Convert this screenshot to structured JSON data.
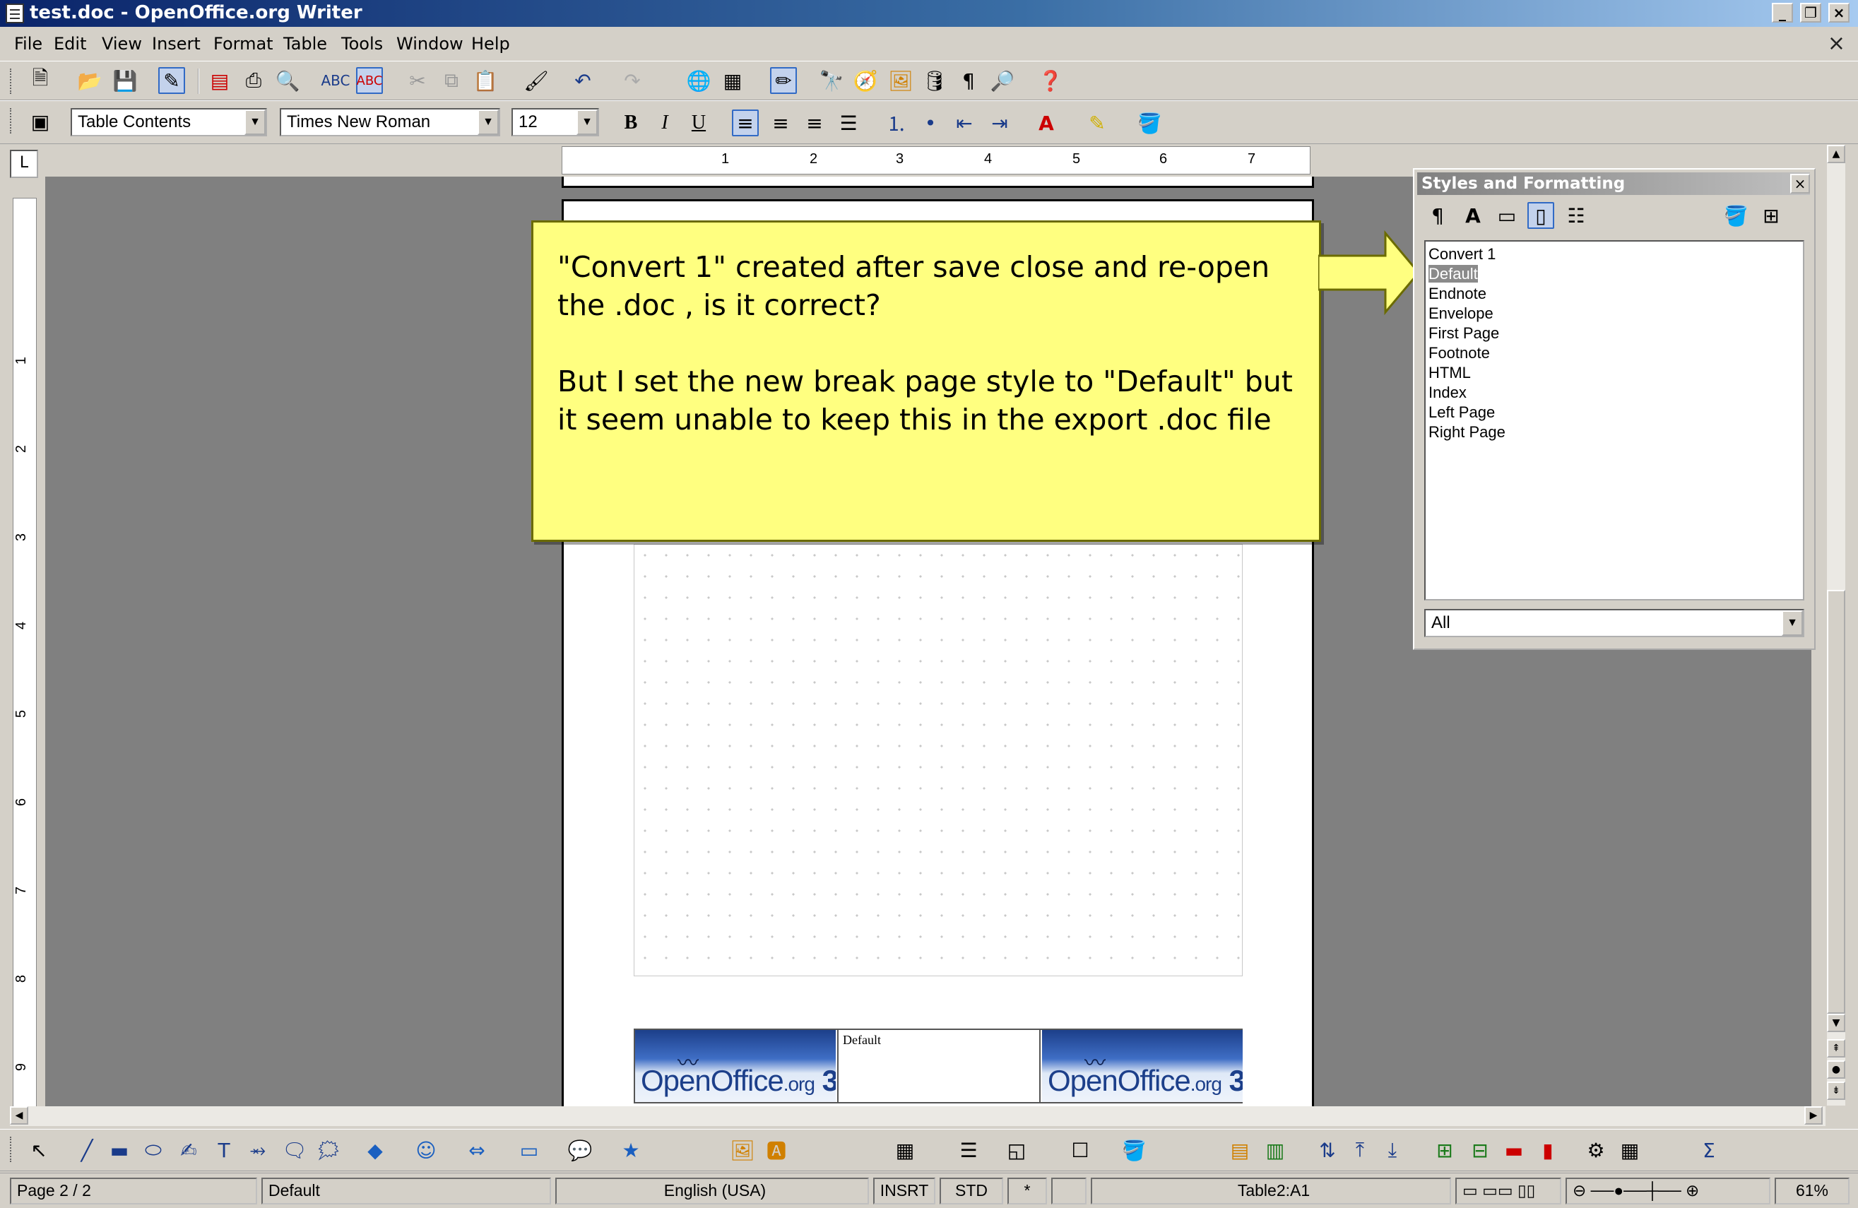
{
  "window": {
    "title": "test.doc - OpenOffice.org Writer",
    "min": "_",
    "restore": "❐",
    "close": "×"
  },
  "menu": [
    "File",
    "Edit",
    "View",
    "Insert",
    "Format",
    "Table",
    "Tools",
    "Window",
    "Help"
  ],
  "menu_close": "×",
  "format_toolbar": {
    "paragraph_style": "Table Contents",
    "font_name": "Times New Roman",
    "font_size": "12",
    "bold": "B",
    "italic": "I",
    "underline": "U",
    "font_color_label": "A"
  },
  "ruler": {
    "corner": "L",
    "h_ticks": [
      "1",
      "2",
      "3",
      "4",
      "5",
      "6",
      "7"
    ],
    "v_ticks": [
      "1",
      "2",
      "3",
      "4",
      "5",
      "6",
      "7",
      "8",
      "9"
    ]
  },
  "callout": {
    "line1": "\"Convert 1\" created after save close and re-open the .doc , is it correct?",
    "line2": "But I set the new break page style to \"Default\" but it seem unable to keep this in the export .doc file"
  },
  "styles_panel": {
    "title": "Styles and Formatting",
    "close": "×",
    "items": [
      "Convert 1",
      "Default",
      "Endnote",
      "Envelope",
      "First Page",
      "Footnote",
      "HTML",
      "Index",
      "Left Page",
      "Right Page"
    ],
    "selected": "Default",
    "filter": "All"
  },
  "document": {
    "footer_label": "Default",
    "logo_text": "OpenOffice",
    "logo_small": ".org",
    "logo_num": "3"
  },
  "statusbar": {
    "page": "Page 2 / 2",
    "page_style": "Default",
    "language": "English (USA)",
    "insert_mode": "INSRT",
    "selection_mode": "STD",
    "modified": "*",
    "cell_ref": "Table2:A1",
    "zoom": "61%"
  },
  "colors": {
    "titlebar": "#0a246a",
    "callout_bg": "#ffff80",
    "canvas": "#808080",
    "chrome": "#d4d0c8"
  }
}
